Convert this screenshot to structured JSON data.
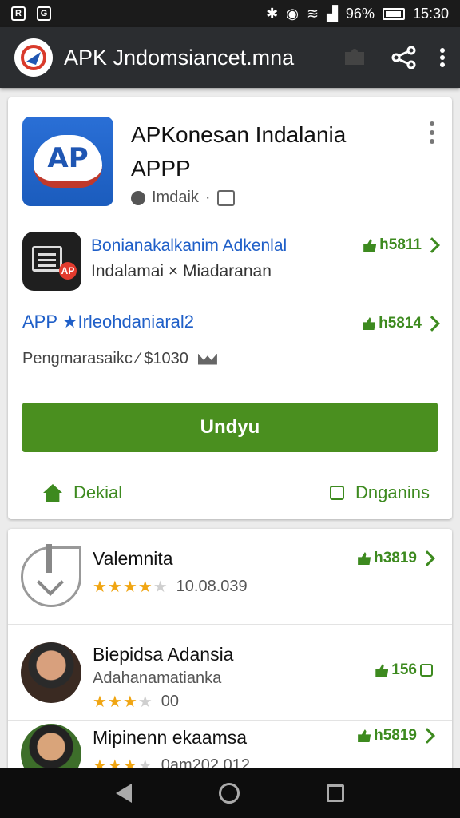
{
  "status_bar": {
    "battery": "⁠96%",
    "time": "15:30"
  },
  "toolbar": {
    "title": "APK Jndomsiancet.mna"
  },
  "app": {
    "icon_text": "AP",
    "title_line1": "APKonesan Indalania",
    "title_line2": "APPP",
    "developer": "Imdaik"
  },
  "related": {
    "title": "Bonianakalkanim Adkenlal",
    "subtitle": "Indalamai × Miadaranan",
    "stat": "h5811",
    "badge": "AP"
  },
  "app_line": {
    "text": "APP ★Irleohdaniaral2",
    "stat": "h5814"
  },
  "price_line": {
    "text": "Pengmarasaikc ⁄ $1030"
  },
  "install_button": "Undyu",
  "card_actions": {
    "left": "Dekial",
    "right": "Dnganins"
  },
  "list": [
    {
      "title": "Valemnita",
      "rating_text": "10.08.039",
      "stars": 4,
      "stat": "h3819"
    },
    {
      "title": "Biepidsa Adansia",
      "subtitle": "Adahanamatianka",
      "rating_text": "00",
      "stars": 3,
      "stat": "156"
    },
    {
      "title": "Mipinenn ekaamsa",
      "rating_text": "0am202.012",
      "stars": 3,
      "stat": "h5819"
    }
  ],
  "colors": {
    "accent_green": "#4a8f1f",
    "link_blue": "#1f5fc8",
    "toolbar": "#2b2d30"
  }
}
